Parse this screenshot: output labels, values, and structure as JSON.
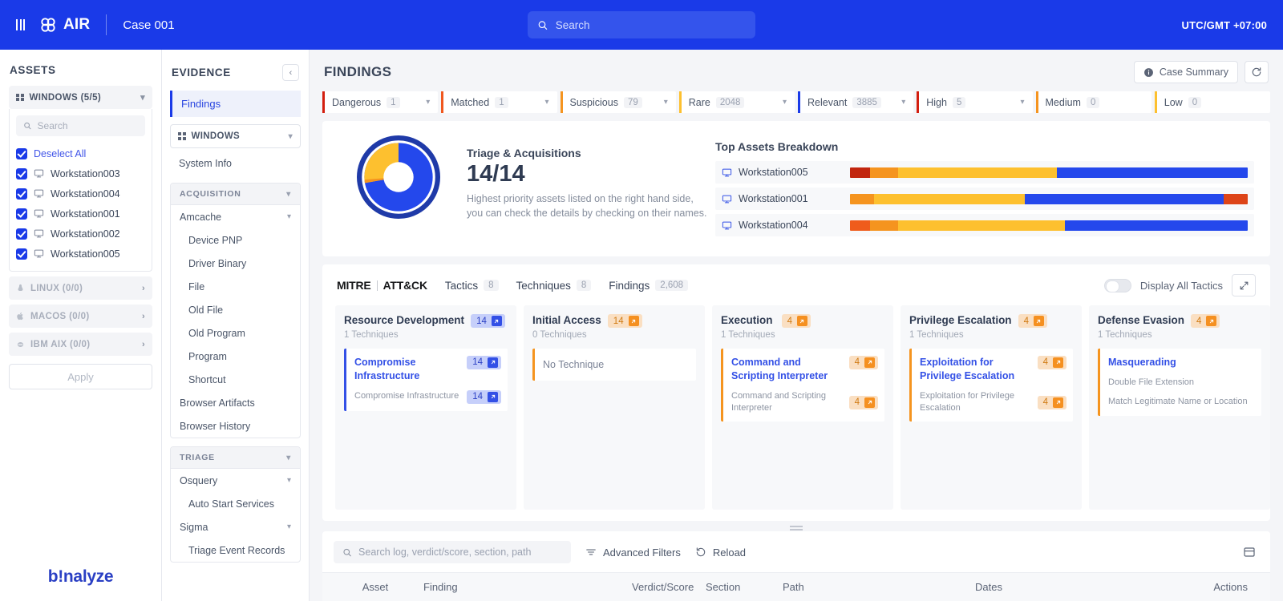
{
  "topbar": {
    "menu_icon": "hamburger-icon",
    "brand": "AIR",
    "case_name": "Case 001",
    "search_placeholder": "Search",
    "search_value": "",
    "timezone": "UTC/GMT +07:00"
  },
  "assets": {
    "title": "ASSETS",
    "windows_group": "WINDOWS (5/5)",
    "search_placeholder": "Search",
    "search_value": "",
    "deselect_all": "Deselect All",
    "hosts": [
      "Workstation003",
      "Workstation004",
      "Workstation001",
      "Workstation002",
      "Workstation005"
    ],
    "other_groups": [
      {
        "label": "LINUX (0/0)",
        "icon": "linux-icon"
      },
      {
        "label": "MACOS (0/0)",
        "icon": "apple-icon"
      },
      {
        "label": "IBM AIX (0/0)",
        "icon": "aix-icon"
      }
    ],
    "apply_label": "Apply",
    "footer_logo": "b!nalyze"
  },
  "evidence": {
    "title": "EVIDENCE",
    "active_item": "Findings",
    "platform_select": "WINDOWS",
    "system_info": "System Info",
    "acquisition_label": "ACQUISITION",
    "acquisition_items": [
      {
        "label": "Amcache",
        "level": 1,
        "caret": true
      },
      {
        "label": "Device PNP",
        "level": 2,
        "caret": false
      },
      {
        "label": "Driver Binary",
        "level": 2,
        "caret": false
      },
      {
        "label": "File",
        "level": 2,
        "caret": false
      },
      {
        "label": "Old File",
        "level": 2,
        "caret": false
      },
      {
        "label": "Old Program",
        "level": 2,
        "caret": false
      },
      {
        "label": "Program",
        "level": 2,
        "caret": false
      },
      {
        "label": "Shortcut",
        "level": 2,
        "caret": false
      },
      {
        "label": "Browser Artifacts",
        "level": 1,
        "caret": false
      },
      {
        "label": "Browser History",
        "level": 1,
        "caret": false
      }
    ],
    "triage_label": "TRIAGE",
    "triage_items": [
      {
        "label": "Osquery",
        "level": 1,
        "caret": true
      },
      {
        "label": "Auto Start Services",
        "level": 2,
        "caret": false
      },
      {
        "label": "Sigma",
        "level": 1,
        "caret": true
      },
      {
        "label": "Triage Event Records",
        "level": 2,
        "caret": false
      }
    ]
  },
  "main": {
    "page_title": "FINDINGS",
    "case_summary_label": "Case Summary",
    "refresh_icon": "refresh-icon",
    "filters": [
      {
        "label": "Dangerous",
        "count": "1",
        "color": "#d31e0f",
        "dropdown": true
      },
      {
        "label": "Matched",
        "count": "1",
        "color": "#f0571e",
        "dropdown": true
      },
      {
        "label": "Suspicious",
        "count": "79",
        "color": "#f5941f",
        "dropdown": true
      },
      {
        "label": "Rare",
        "count": "2048",
        "color": "#fdc02f",
        "dropdown": true
      },
      {
        "label": "Relevant",
        "count": "3885",
        "color": "#1a3ae8",
        "dropdown": true
      },
      {
        "label": "High",
        "count": "5",
        "color": "#d31e0f",
        "dropdown": true
      },
      {
        "label": "Medium",
        "count": "0",
        "color": "#f5941f",
        "dropdown": false
      },
      {
        "label": "Low",
        "count": "0",
        "color": "#fdc02f",
        "dropdown": false
      }
    ],
    "summary": {
      "triage_title": "Triage & Acquisitions",
      "triage_value": "14/14",
      "triage_desc": "Highest priority assets listed on the right hand side, you can check the details by checking on their names.",
      "breakdown_title": "Top Assets Breakdown",
      "rows": [
        {
          "name": "Workstation005",
          "segments": [
            {
              "color": "#c2260f",
              "pct": 5
            },
            {
              "color": "#f5941f",
              "pct": 7
            },
            {
              "color": "#fdc02f",
              "pct": 40
            },
            {
              "color": "#2448ec",
              "pct": 48
            }
          ]
        },
        {
          "name": "Workstation001",
          "segments": [
            {
              "color": "#f5941f",
              "pct": 6
            },
            {
              "color": "#fdc02f",
              "pct": 38
            },
            {
              "color": "#2448ec",
              "pct": 50
            },
            {
              "color": "#dd4418",
              "pct": 6
            }
          ]
        },
        {
          "name": "Workstation004",
          "segments": [
            {
              "color": "#ef5c1c",
              "pct": 5
            },
            {
              "color": "#f5941f",
              "pct": 7
            },
            {
              "color": "#fdc02f",
              "pct": 42
            },
            {
              "color": "#2448ec",
              "pct": 46
            }
          ]
        }
      ]
    },
    "mitre": {
      "logo_left": "MITRE",
      "logo_right": "ATT&CK",
      "tabs": [
        {
          "label": "Tactics",
          "count": "8"
        },
        {
          "label": "Techniques",
          "count": "8"
        },
        {
          "label": "Findings",
          "count": "2,608"
        }
      ],
      "toggle_label": "Display All Tactics",
      "toggle_on": false,
      "expand_icon": "expand-icon",
      "tactics": [
        {
          "title": "Resource Development",
          "subtitle": "1 Techniques",
          "badge": {
            "count": "14",
            "tone": "blue"
          },
          "accent": "#3350e6",
          "techniques": [
            {
              "name": "Compromise Infrastructure",
              "badge": {
                "count": "14",
                "tone": "blue"
              },
              "subs": [
                {
                  "name": "Compromise Infrastructure",
                  "badge": {
                    "count": "14",
                    "tone": "blue"
                  }
                }
              ]
            }
          ]
        },
        {
          "title": "Initial Access",
          "subtitle": "0 Techniques",
          "badge": {
            "count": "14",
            "tone": "orange"
          },
          "accent": "#f5941f",
          "empty_label": "No Technique",
          "techniques": []
        },
        {
          "title": "Execution",
          "subtitle": "1 Techniques",
          "badge": {
            "count": "4",
            "tone": "orange"
          },
          "accent": "#f5941f",
          "techniques": [
            {
              "name": "Command and Scripting Interpreter",
              "badge": {
                "count": "4",
                "tone": "orange"
              },
              "subs": [
                {
                  "name": "Command and Scripting Interpreter",
                  "badge": {
                    "count": "4",
                    "tone": "orange"
                  }
                }
              ]
            }
          ]
        },
        {
          "title": "Privilege Escalation",
          "subtitle": "1 Techniques",
          "badge": {
            "count": "4",
            "tone": "orange"
          },
          "accent": "#f5941f",
          "techniques": [
            {
              "name": "Exploitation for Privilege Escalation",
              "badge": {
                "count": "4",
                "tone": "orange"
              },
              "subs": [
                {
                  "name": "Exploitation for Privilege Escalation",
                  "badge": {
                    "count": "4",
                    "tone": "orange"
                  }
                }
              ]
            }
          ]
        },
        {
          "title": "Defense Evasion",
          "subtitle": "1 Techniques",
          "badge": {
            "count": "4",
            "tone": "orange"
          },
          "accent": "#f5941f",
          "techniques": [
            {
              "name": "Masquerading",
              "badge": {
                "count": "",
                "tone": "orange"
              },
              "subs": [
                {
                  "name": "Double File Extension",
                  "badge": {
                    "count": "",
                    "tone": "orange"
                  }
                },
                {
                  "name": "Match Legitimate Name or Location",
                  "badge": {
                    "count": "",
                    "tone": "orange"
                  }
                }
              ]
            }
          ]
        }
      ]
    },
    "table": {
      "search_placeholder": "Search log, verdict/score, section, path",
      "search_value": "",
      "advanced_filters": "Advanced Filters",
      "reload": "Reload",
      "columns": [
        "Asset",
        "Finding",
        "Verdict/Score",
        "Section",
        "Path",
        "Dates",
        "Actions"
      ]
    }
  }
}
